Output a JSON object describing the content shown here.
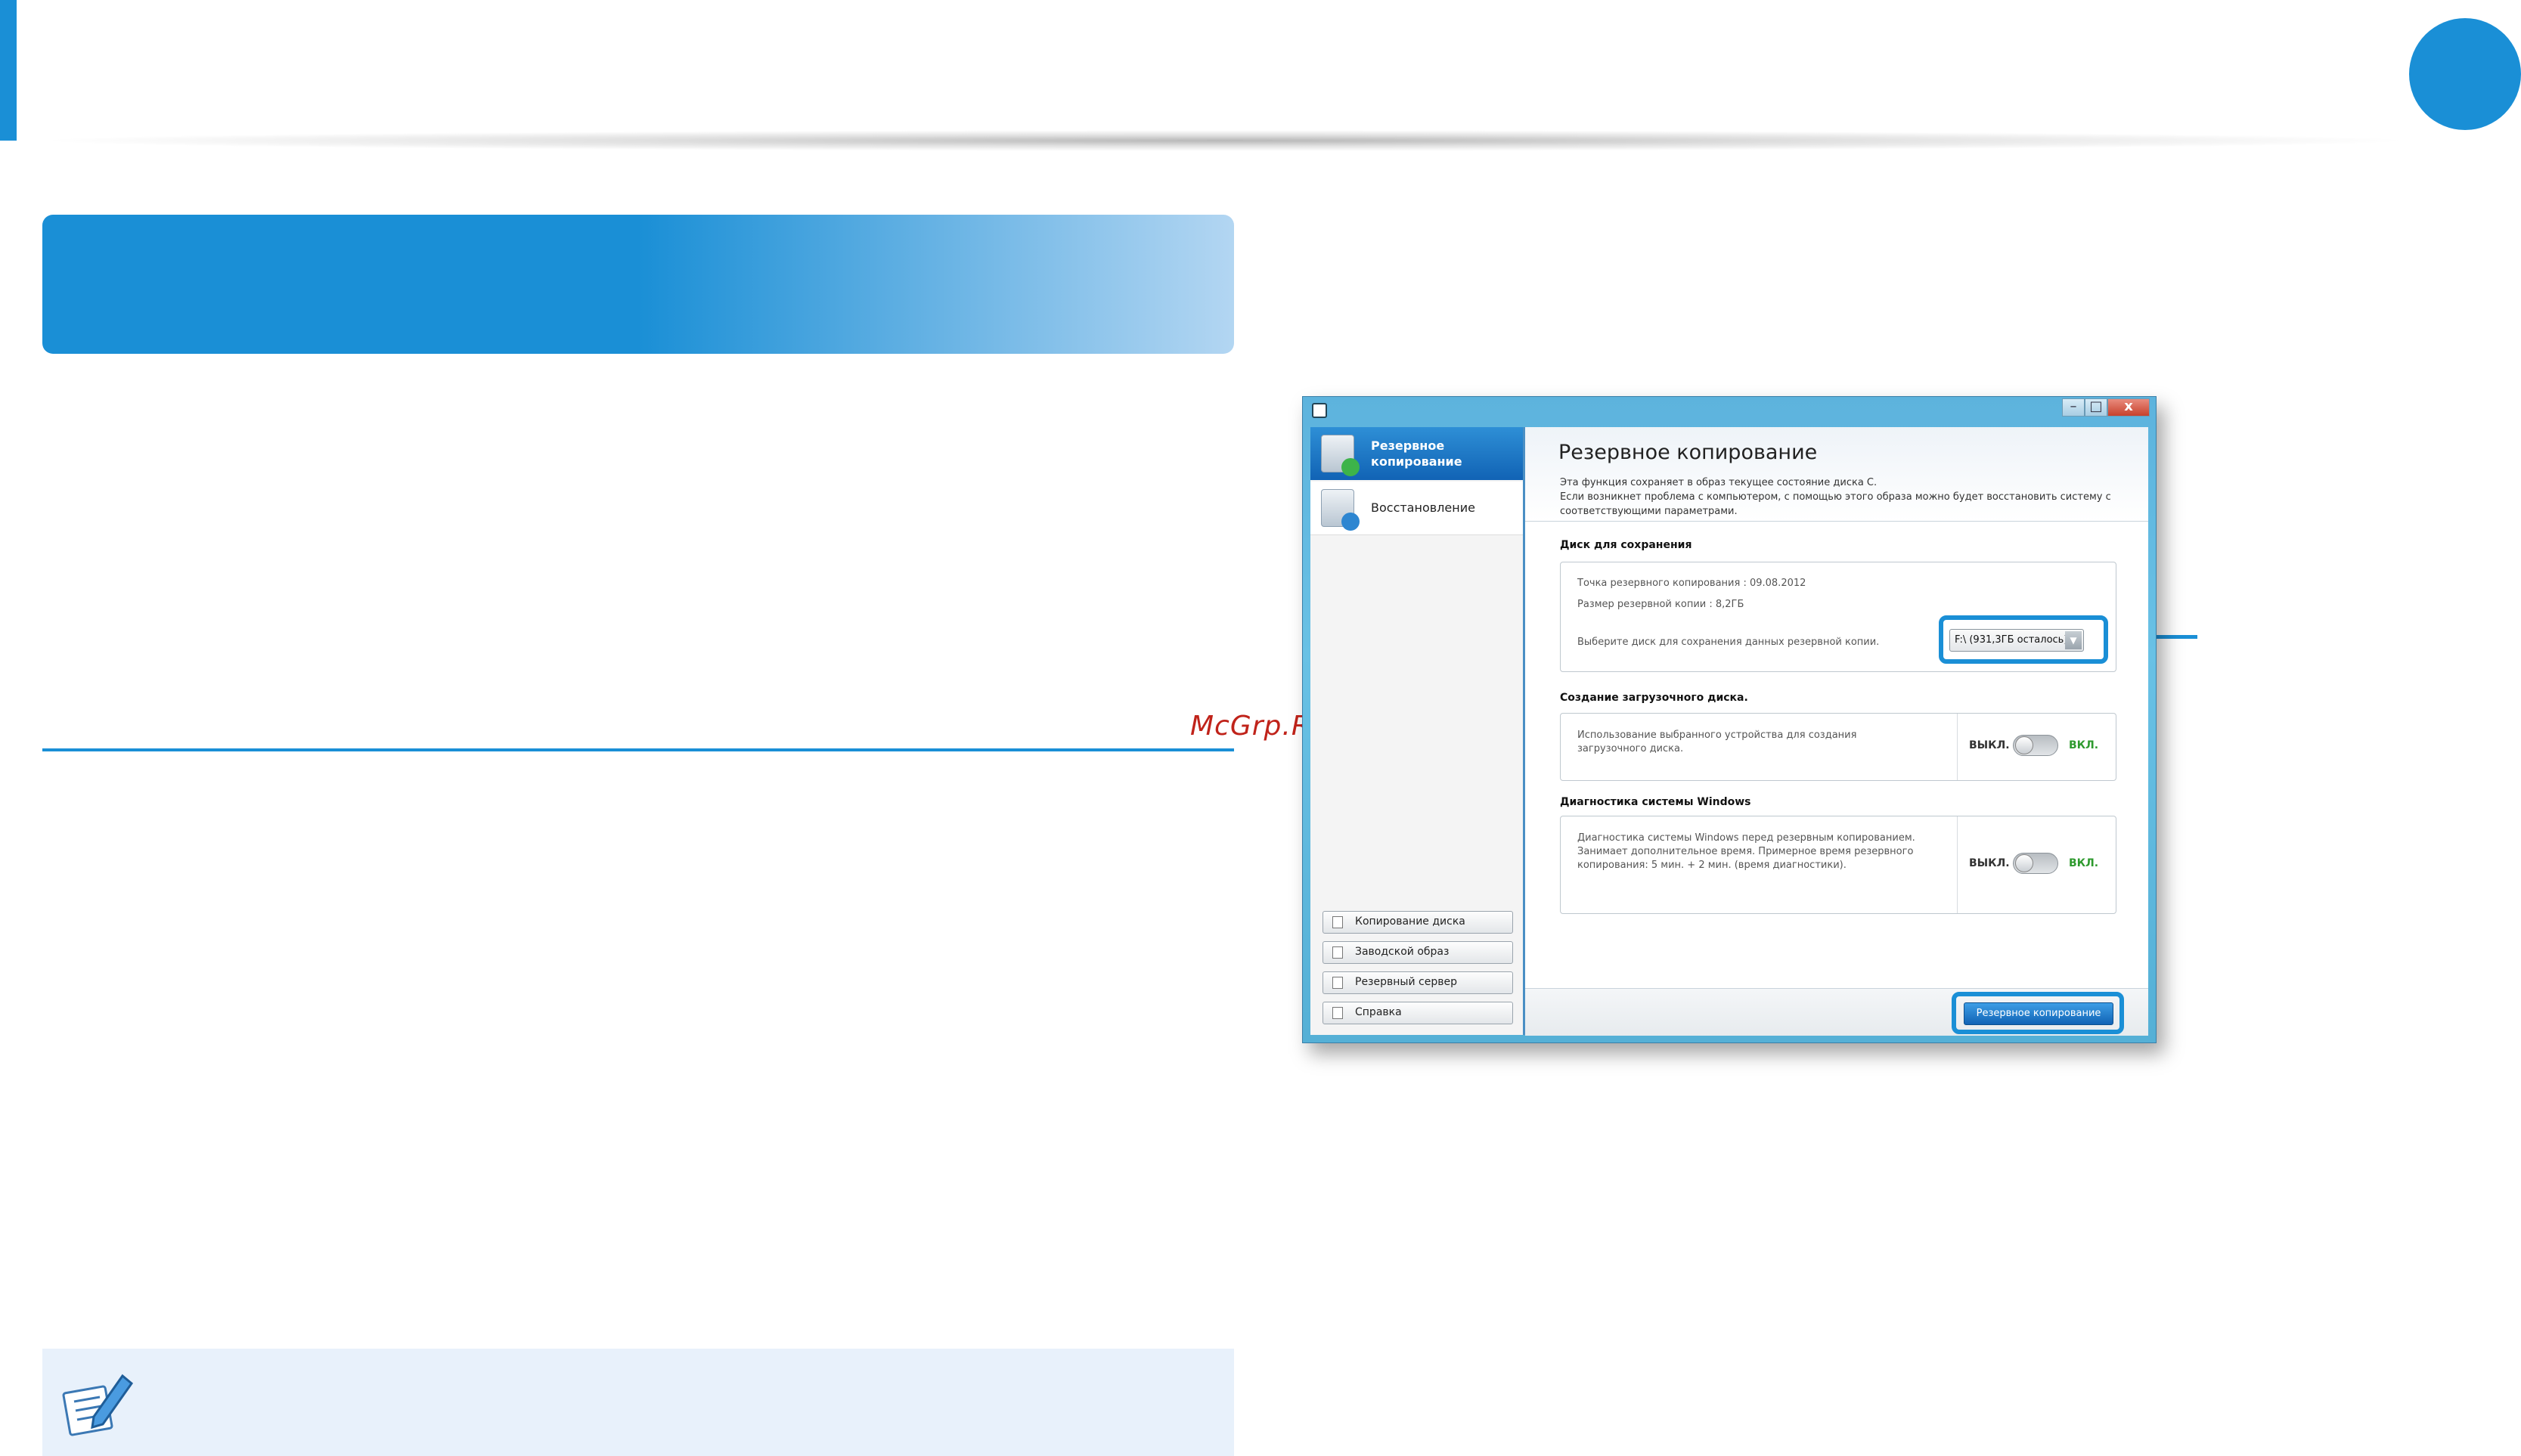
{
  "watermark": "McGrp.Ru",
  "app": {
    "window_controls": {
      "minimize": "–",
      "maximize": "□",
      "close": "x"
    },
    "sidebar": {
      "nav": [
        {
          "label": "Резервное копирование",
          "icon": "backup-icon",
          "active": true
        },
        {
          "label": "Восстановление",
          "icon": "restore-icon",
          "active": false
        }
      ],
      "buttons": [
        {
          "label": "Копирование диска",
          "icon": "disk-copy-icon"
        },
        {
          "label": "Заводской образ",
          "icon": "factory-image-icon"
        },
        {
          "label": "Резервный сервер",
          "icon": "backup-server-icon"
        },
        {
          "label": "Справка",
          "icon": "help-icon"
        }
      ]
    },
    "main": {
      "title": "Резервное копирование",
      "description_line1": "Эта функция сохраняет в образ текущее состояние диска С.",
      "description_line2": "Если возникнет проблема с компьютером, с помощью этого образа можно будет восстановить систему с соответствующими параметрами.",
      "disk_section": {
        "title": "Диск для сохранения",
        "backup_point": "Точка резервного копирования : 09.08.2012",
        "backup_size": "Размер резервной копии : 8,2ГБ",
        "choose_disk_label": "Выберите диск для сохранения данных резервной копии.",
        "selected_disk": "F:\\ (931,3ГБ осталось)"
      },
      "boot_section": {
        "title": "Создание загрузочного диска.",
        "text": "Использование выбранного устройства для создания загрузочного диска.",
        "off_label": "ВЫКЛ.",
        "on_label": "ВКЛ."
      },
      "diag_section": {
        "title": "Диагностика системы Windows",
        "text": "Диагностика системы Windows перед резервным копированием. Занимает дополнительное время. Примерное время резервного копирования: 5 мин. + 2 мин. (время диагностики).",
        "off_label": "ВЫКЛ.",
        "on_label": "ВКЛ."
      },
      "backup_button": "Резервное копирование"
    }
  },
  "colors": {
    "accent": "#1a8fd6",
    "watermark": "#c0231a",
    "on_label": "#2e9a2e",
    "note_bg": "#e8f1fb"
  }
}
